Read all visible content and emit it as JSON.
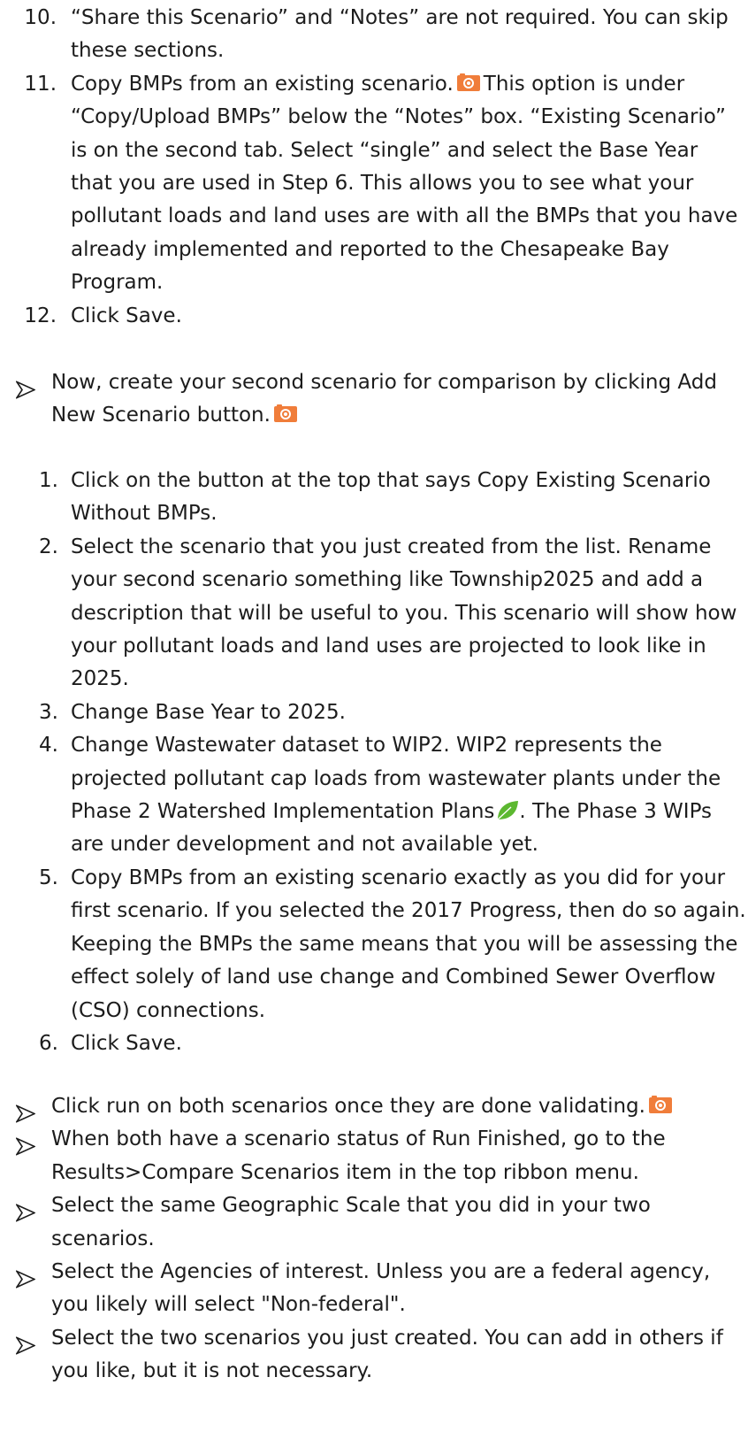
{
  "colors": {
    "text": "#1c1c1c",
    "camera_icon": "#f07d3a",
    "leaf_icon": "#5cb830",
    "background": "#ffffff"
  },
  "icons": {
    "camera": "camera-icon",
    "leaf": "leaf-icon",
    "bullet": "arrowhead-bullet-icon"
  },
  "first_steps": [
    {
      "num": "10.",
      "text": "“Share this Scenario” and “Notes” are not required. You can skip these sections."
    },
    {
      "num": "11.",
      "text_before": "Copy BMPs from an existing scenario.",
      "text_after": "This option is under “Copy/Upload BMPs” below the “Notes” box. “Existing Scenario” is on the second tab. Select “single” and select the Base Year that you are used in Step 6. This allows you to see what your pollutant loads and land uses are with all the BMPs that you have already implemented and reported to the Chesapeake Bay Program."
    },
    {
      "num": "12.",
      "text": "Click Save."
    }
  ],
  "second_scenario_intro": "Now, create your second scenario for comparison by clicking Add New Scenario button.",
  "second_steps": [
    {
      "num": "1.",
      "text": "Click on the button at the top that says Copy Existing Scenario Without BMPs."
    },
    {
      "num": "2.",
      "text": "Select the scenario that you just created from the list. Rename your second scenario something like Township2025 and add a description that will be useful to you. This scenario will show how your pollutant loads and land uses are projected to look like in 2025."
    },
    {
      "num": "3.",
      "text": "Change Base Year to 2025."
    },
    {
      "num": "4.",
      "text_before": "Change Wastewater dataset to WIP2. WIP2 represents the projected pollutant cap loads from wastewater plants under the Phase 2 Watershed Implementation Plans",
      "text_after": ". The Phase 3 WIPs are under development and not available yet."
    },
    {
      "num": "5.",
      "text": "Copy BMPs from an existing scenario exactly as you did for your first scenario. If you selected the 2017 Progress, then do so again. Keeping the BMPs the same means that you will be assessing the effect solely of land use change and Combined Sewer Overflow (CSO) connections."
    },
    {
      "num": "6.",
      "text": "Click Save."
    }
  ],
  "final_bullets": [
    "Click run on both scenarios once they are done validating.",
    "When both have a scenario status of Run Finished, go to the Results>Compare Scenarios item in the top ribbon menu.",
    "Select the same Geographic Scale that you did in your two scenarios.",
    "Select the Agencies of interest. Unless you are a federal agency, you likely will select \"Non-federal\".",
    "Select the two scenarios you just created. You can add in others if you like, but it is not necessary."
  ]
}
